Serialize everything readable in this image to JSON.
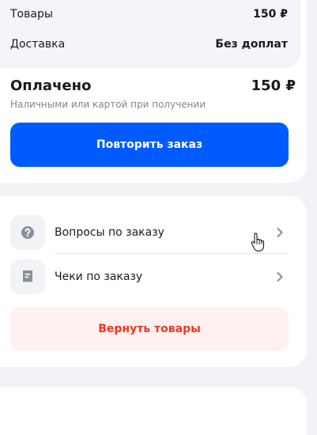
{
  "summary": {
    "goods_label": "Товары",
    "goods_value": "150 ₽",
    "delivery_label": "Доставка",
    "delivery_value": "Без доплат"
  },
  "payment": {
    "status_label": "Оплачено",
    "amount": "150 ₽",
    "method": "Наличными или картой при получении",
    "repeat_button": "Повторить заказ"
  },
  "menu": {
    "items": [
      {
        "label": "Вопросы по заказу",
        "icon": "question-icon"
      },
      {
        "label": "Чеки по заказу",
        "icon": "receipt-icon"
      }
    ],
    "return_button": "Вернуть товары"
  },
  "colors": {
    "primary": "#005bff",
    "danger": "#f1361d",
    "danger_bg": "#fff1ef",
    "page_bg": "#f2f3f7"
  }
}
